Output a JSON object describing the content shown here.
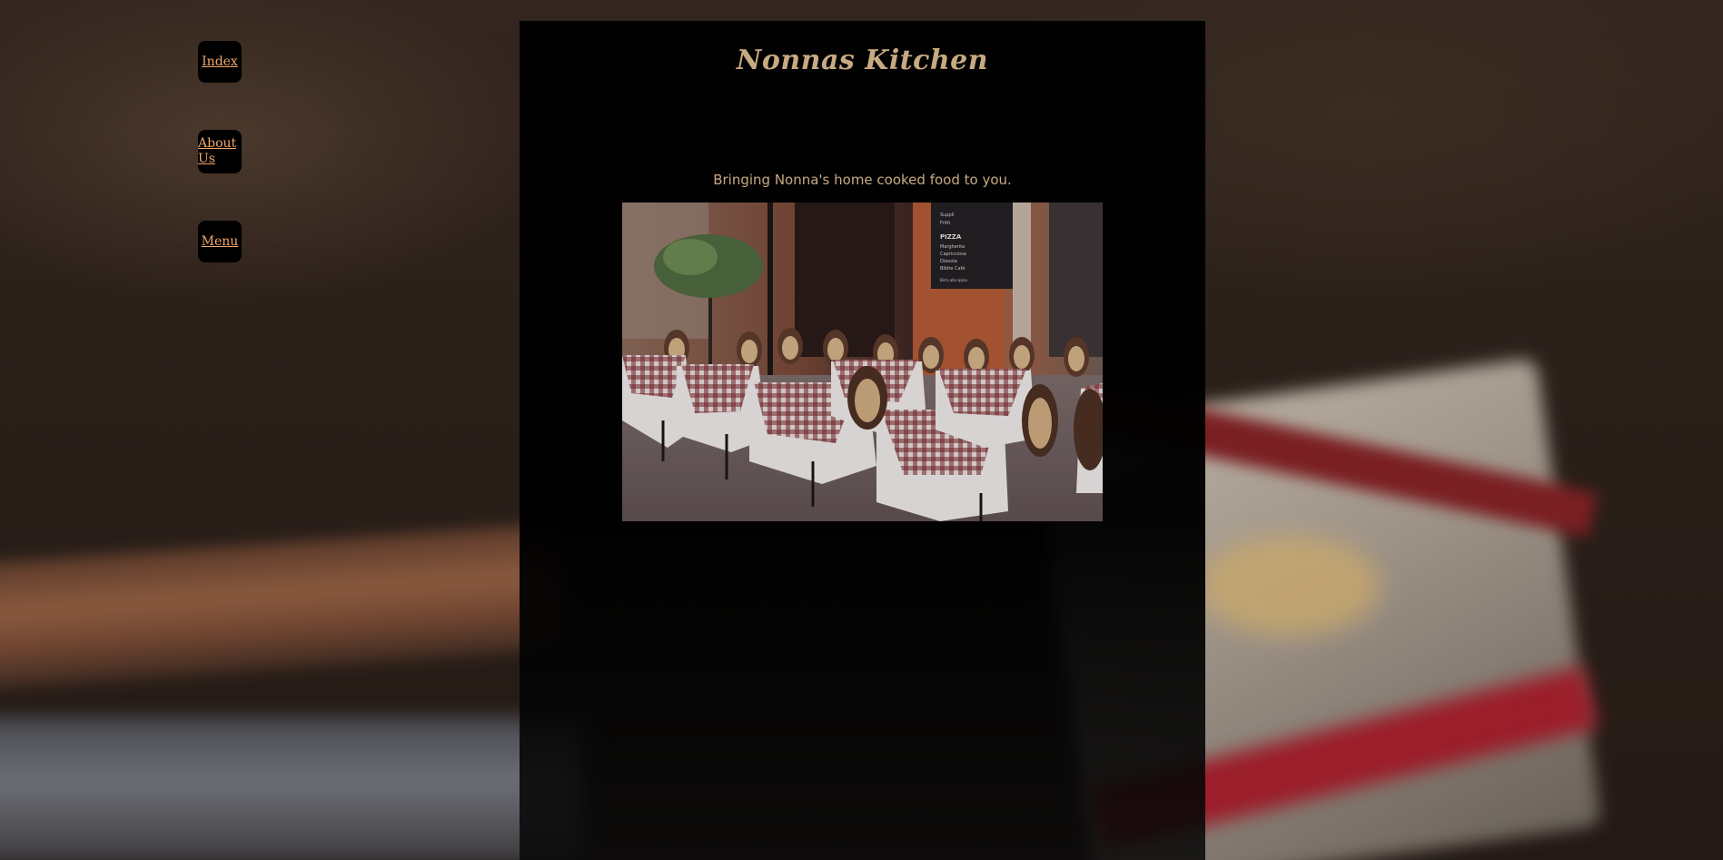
{
  "site": {
    "title": "Nonnas Kitchen",
    "tagline": "Bringing Nonna's home cooked food to you."
  },
  "nav": {
    "items": [
      {
        "label": "Index"
      },
      {
        "label": "About Us"
      },
      {
        "label": "Menu"
      }
    ]
  },
  "hero": {
    "chalkboard": [
      "Supplì",
      "Fritti",
      "PIZZA",
      "Margherita",
      "Capricciosa",
      "Diavola",
      "Bibite Café",
      "Birra alla spina"
    ]
  },
  "colors": {
    "accent_gold": "#c8aa82",
    "nav_link": "#f2a76a",
    "panel_bg": "#000000"
  }
}
